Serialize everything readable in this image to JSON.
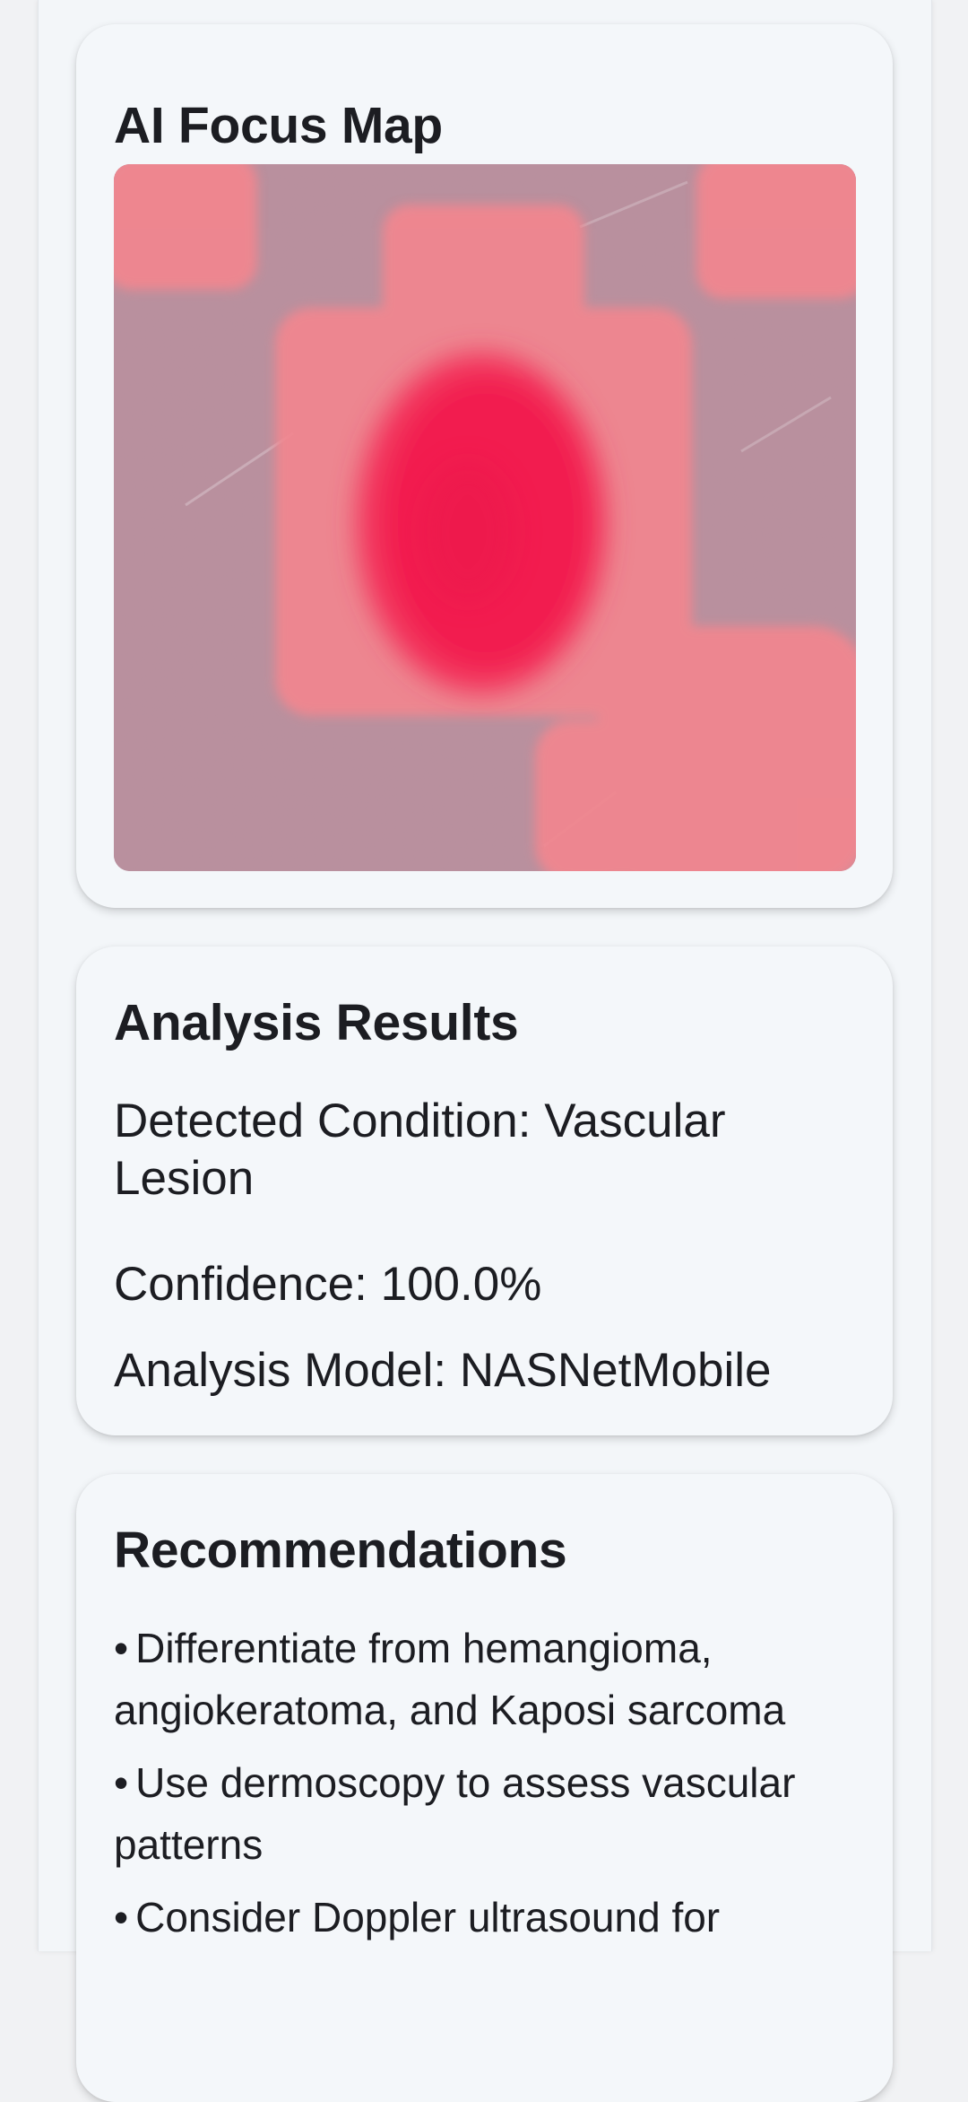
{
  "focus_map": {
    "title": "AI Focus Map"
  },
  "analysis": {
    "title": "Analysis Results",
    "condition_label": "Detected Condition:",
    "condition_value": "Vascular Lesion",
    "confidence_label": "Confidence:",
    "confidence_value": "100.0%",
    "model_label": "Analysis Model:",
    "model_value": "NASNetMobile"
  },
  "recommendations": {
    "title": "Recommendations",
    "items": [
      "Differentiate from hemangioma, angiokeratoma, and Kaposi sarcoma",
      "Use dermoscopy to assess vascular patterns",
      "Consider Doppler ultrasound for"
    ],
    "bullet": "•"
  },
  "colors": {
    "skin_base": "#b98f9d",
    "attention_low": "#f2868f",
    "attention_high": "#f21e50"
  }
}
